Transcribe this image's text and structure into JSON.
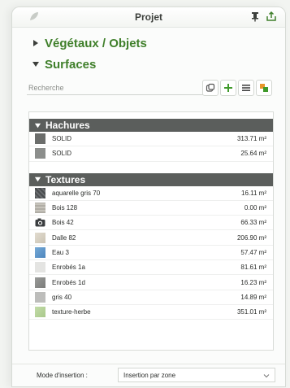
{
  "window": {
    "title": "Projet"
  },
  "sections": {
    "vegetaux": {
      "label": "Végétaux / Objets",
      "expanded": false
    },
    "surfaces": {
      "label": "Surfaces",
      "expanded": true
    }
  },
  "search": {
    "placeholder": "Recherche"
  },
  "colors": {
    "accent_green": "#3f7f2a",
    "group_header": "#5b5e5c"
  },
  "toolbar": {
    "icons": [
      "duplicate-icon",
      "add-icon",
      "list-icon",
      "color-icon"
    ]
  },
  "groups": {
    "hachures": {
      "label": "Hachures",
      "rows": [
        {
          "name": "SOLID",
          "area": "313.71 m²",
          "swatch": "#6b6d6b"
        },
        {
          "name": "SOLID",
          "area": "25.64 m²",
          "swatch": "#8c8e8c"
        }
      ]
    },
    "textures": {
      "label": "Textures",
      "rows": [
        {
          "name": "aquarelle gris 70",
          "area": "16.11 m²",
          "swatch": "#55585a"
        },
        {
          "name": "Bois 128",
          "area": "0.00 m²",
          "swatch": "#b9b6ae"
        },
        {
          "name": "Bois 42",
          "area": "66.33 m²",
          "swatch": "photo"
        },
        {
          "name": "Dalle 82",
          "area": "206.90 m²",
          "swatch": "#d8d2c6"
        },
        {
          "name": "Eau 3",
          "area": "57.47 m²",
          "swatch": "#5f96c9"
        },
        {
          "name": "Enrobés 1a",
          "area": "81.61 m²",
          "swatch": "#e4e4e2"
        },
        {
          "name": "Enrobés 1d",
          "area": "16.23 m²",
          "swatch": "#8a8b89"
        },
        {
          "name": "gris 40",
          "area": "14.89 m²",
          "swatch": "#bdbdbb"
        },
        {
          "name": "texture-herbe",
          "area": "351.01 m²",
          "swatch": "#b7d39a"
        }
      ]
    }
  },
  "insertion": {
    "label": "Mode d'insertion :",
    "value": "Insertion par zone"
  }
}
